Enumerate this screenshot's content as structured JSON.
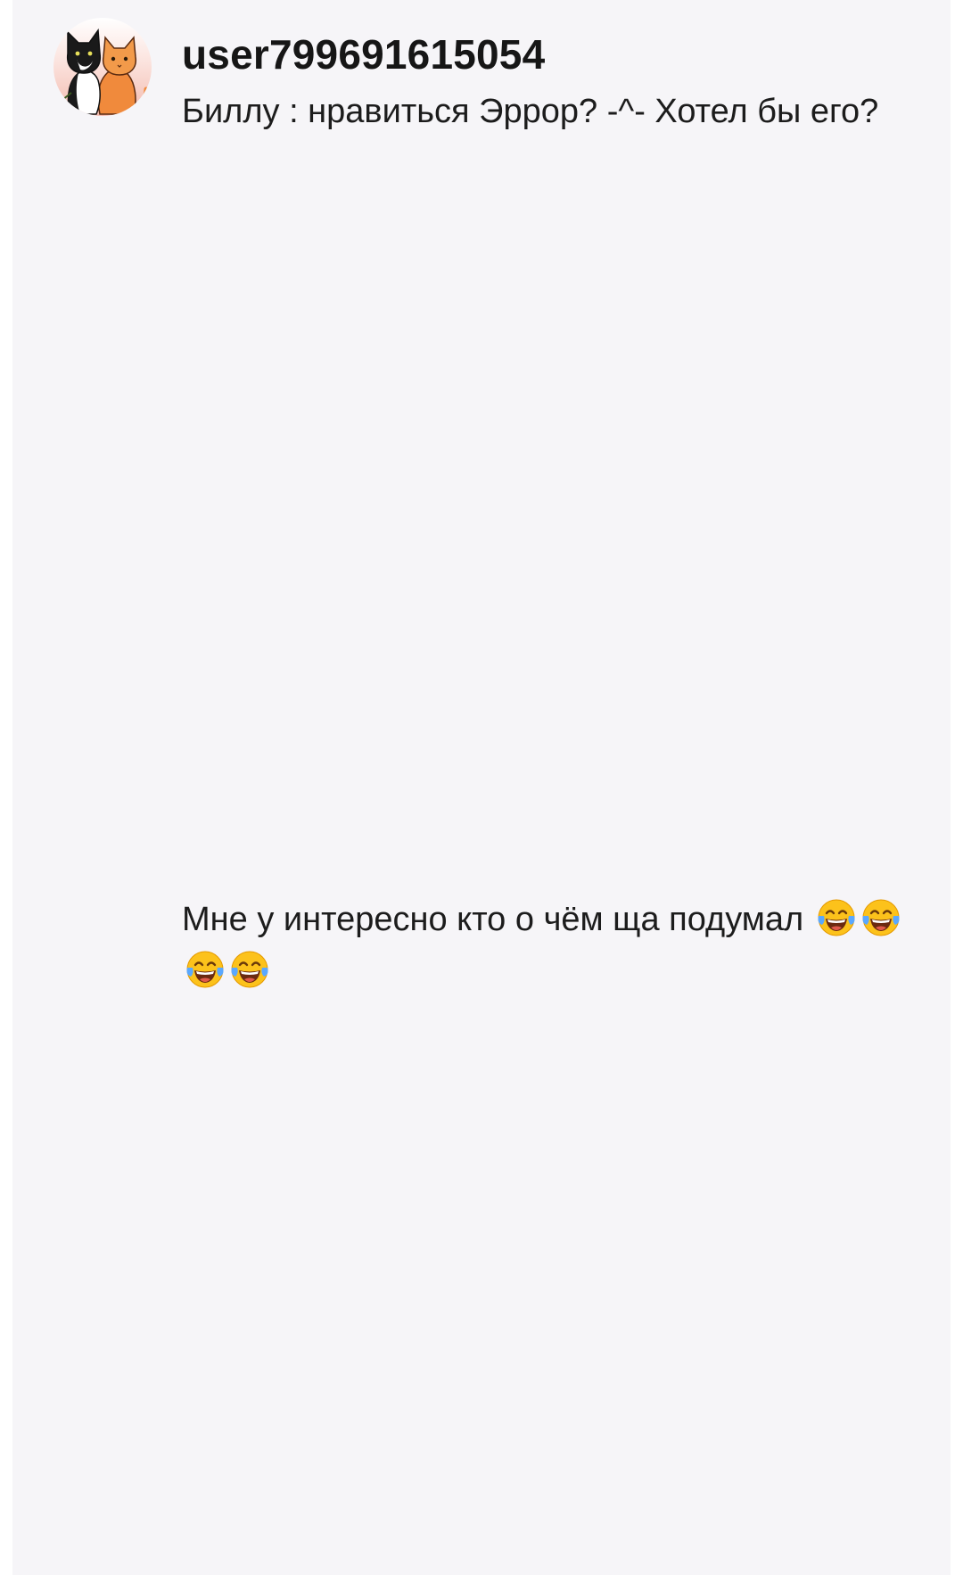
{
  "comment": {
    "avatar_icon": "cats-avatar-icon",
    "username": "user799691615054",
    "text": "Биллу : нравиться Эррор?  -^- Хотел бы его?"
  },
  "reply": {
    "text": "Мне у интересно кто о чём ща подумал",
    "emoji_icon": "face-with-tears-of-joy-icon",
    "emoji_count": 4
  },
  "colors": {
    "card_background": "#f6f5f8",
    "page_background": "#ffffff",
    "text": "#1c1c1c"
  }
}
